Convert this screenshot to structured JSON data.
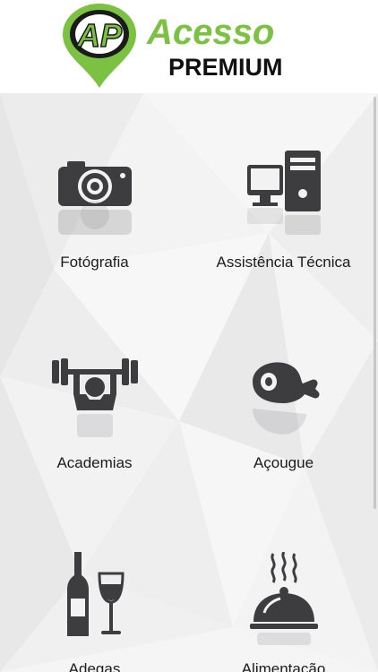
{
  "brand": {
    "logo_monogram": "AP",
    "title": "Acesso",
    "subtitle": "PREMIUM",
    "colors": {
      "green": "#7cc242",
      "dark": "#111111"
    }
  },
  "categories": [
    {
      "label": "Fotógrafia",
      "icon": "camera-icon"
    },
    {
      "label": "Assistência Técnica",
      "icon": "computer-icon"
    },
    {
      "label": "Academias",
      "icon": "weightlifter-icon"
    },
    {
      "label": "Açougue",
      "icon": "meat-icon"
    },
    {
      "label": "Adegas",
      "icon": "wine-icon"
    },
    {
      "label": "Alimentação",
      "icon": "food-cloche-icon"
    }
  ]
}
